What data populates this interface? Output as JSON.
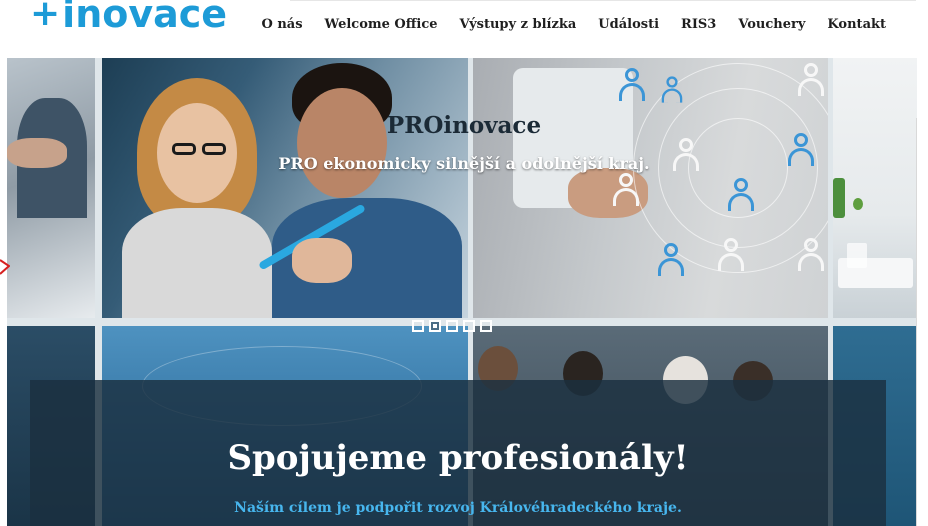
{
  "logo": {
    "plus": "+",
    "text": "inovace"
  },
  "nav": {
    "items": [
      "O nás",
      "Welcome Office",
      "Výstupy z blízka",
      "Události",
      "RIS3",
      "Vouchery",
      "Kontakt"
    ]
  },
  "slide": {
    "title": "PROinovace",
    "subtitle": "PRO ekonomicky silnější a odolnější kraj.",
    "active_index": 1,
    "count": 5
  },
  "hero": {
    "title": "Spojujeme profesionály!",
    "subtitle": "Naším cílem je podpořit rozvoj Královéhradeckého kraje."
  },
  "colors": {
    "brand": "#1d9bd7",
    "overlay": "#1b2f40",
    "accent_text": "#47b6ee"
  }
}
